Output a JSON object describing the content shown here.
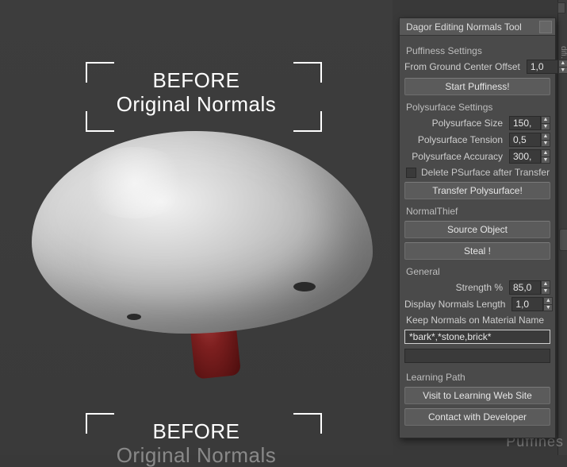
{
  "viewport": {
    "caption1_line1": "BEFORE",
    "caption1_line2": "Original Normals",
    "caption2_line1": "BEFORE",
    "caption2_line2": "Original Normals"
  },
  "panel": {
    "title": "Dagor Editing Normals Tool",
    "sections": {
      "puffiness": {
        "header": "Puffiness Settings",
        "ground_offset_label": "From Ground Center Offset",
        "ground_offset_value": "1,0",
        "start_btn": "Start Puffiness!"
      },
      "polysurface": {
        "header": "Polysurface Settings",
        "size_label": "Polysurface Size",
        "size_value": "150,",
        "tension_label": "Polysurface Tension",
        "tension_value": "0,5",
        "accuracy_label": "Polysurface Accuracy",
        "accuracy_value": "300,",
        "delete_label": "Delete PSurface after Transfer",
        "transfer_btn": "Transfer Polysurface!"
      },
      "normalthief": {
        "header": "NormalThief",
        "source_btn": "Source Object",
        "steal_btn": "Steal !"
      },
      "general": {
        "header": "General",
        "strength_label": "Strength %",
        "strength_value": "85,0",
        "display_len_label": "Display Normals Length",
        "display_len_value": "1,0",
        "keep_label": "Keep Normals on Material Name",
        "keep_value": "*bark*,*stone,brick*",
        "extra_value": ""
      },
      "learning": {
        "header": "Learning Path",
        "visit_btn": "Visit to Learning Web Site",
        "contact_btn": "Contact with Developer"
      }
    }
  },
  "edge": {
    "ghost": "Puffines",
    "side": "difi…  E"
  }
}
